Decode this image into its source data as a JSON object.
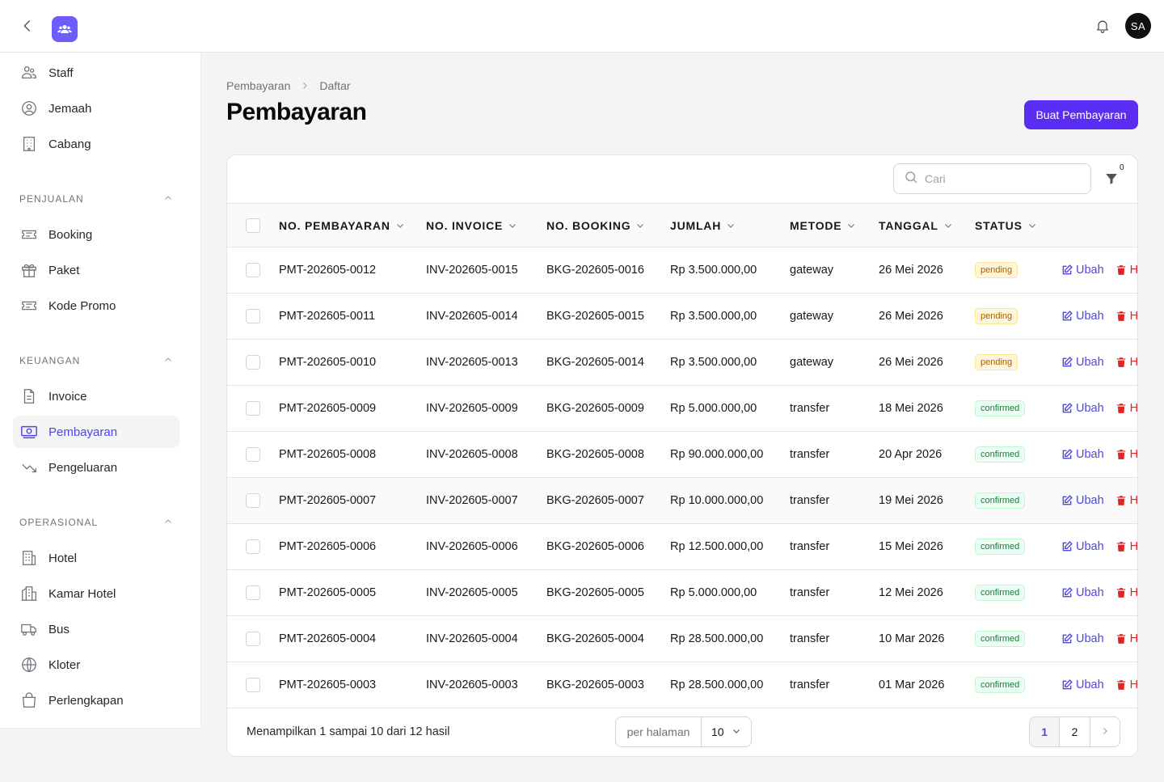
{
  "header": {
    "avatar_initials": "SA",
    "brand_color": "#6d5dfc"
  },
  "sidebar": {
    "top_items": [
      {
        "label": "Staff",
        "icon": "users-icon"
      },
      {
        "label": "Jemaah",
        "icon": "user-circle-icon"
      },
      {
        "label": "Cabang",
        "icon": "building-icon"
      }
    ],
    "groups": [
      {
        "label": "PENJUALAN",
        "items": [
          {
            "label": "Booking",
            "icon": "ticket-icon"
          },
          {
            "label": "Paket",
            "icon": "gift-icon"
          },
          {
            "label": "Kode Promo",
            "icon": "promo-ticket-icon"
          }
        ]
      },
      {
        "label": "KEUANGAN",
        "items": [
          {
            "label": "Invoice",
            "icon": "document-icon"
          },
          {
            "label": "Pembayaran",
            "icon": "banknote-icon",
            "active": true
          },
          {
            "label": "Pengeluaran",
            "icon": "trending-down-icon"
          }
        ]
      },
      {
        "label": "OPERASIONAL",
        "items": [
          {
            "label": "Hotel",
            "icon": "hotel-icon"
          },
          {
            "label": "Kamar Hotel",
            "icon": "hotel-room-icon"
          },
          {
            "label": "Bus",
            "icon": "truck-icon"
          },
          {
            "label": "Kloter",
            "icon": "globe-icon"
          },
          {
            "label": "Perlengkapan",
            "icon": "shopping-bag-icon"
          }
        ]
      }
    ]
  },
  "breadcrumb": {
    "parent": "Pembayaran",
    "current": "Daftar"
  },
  "page": {
    "title": "Pembayaran",
    "create_button": "Buat Pembayaran",
    "accent_color": "#5b2df3"
  },
  "table_toolbar": {
    "search_placeholder": "Cari",
    "filter_count": "0"
  },
  "table": {
    "columns": [
      "NO. PEMBAYARAN",
      "NO. INVOICE",
      "NO. BOOKING",
      "JUMLAH",
      "METODE",
      "TANGGAL",
      "STATUS"
    ],
    "edit_label": "Ubah",
    "delete_label": "H",
    "rows": [
      {
        "no_pembayaran": "PMT-202605-0012",
        "no_invoice": "INV-202605-0015",
        "no_booking": "BKG-202605-0016",
        "jumlah": "Rp 3.500.000,00",
        "metode": "gateway",
        "tanggal": "26 Mei 2026",
        "status": "pending"
      },
      {
        "no_pembayaran": "PMT-202605-0011",
        "no_invoice": "INV-202605-0014",
        "no_booking": "BKG-202605-0015",
        "jumlah": "Rp 3.500.000,00",
        "metode": "gateway",
        "tanggal": "26 Mei 2026",
        "status": "pending"
      },
      {
        "no_pembayaran": "PMT-202605-0010",
        "no_invoice": "INV-202605-0013",
        "no_booking": "BKG-202605-0014",
        "jumlah": "Rp 3.500.000,00",
        "metode": "gateway",
        "tanggal": "26 Mei 2026",
        "status": "pending"
      },
      {
        "no_pembayaran": "PMT-202605-0009",
        "no_invoice": "INV-202605-0009",
        "no_booking": "BKG-202605-0009",
        "jumlah": "Rp 5.000.000,00",
        "metode": "transfer",
        "tanggal": "18 Mei 2026",
        "status": "confirmed"
      },
      {
        "no_pembayaran": "PMT-202605-0008",
        "no_invoice": "INV-202605-0008",
        "no_booking": "BKG-202605-0008",
        "jumlah": "Rp 90.000.000,00",
        "metode": "transfer",
        "tanggal": "20 Apr 2026",
        "status": "confirmed"
      },
      {
        "no_pembayaran": "PMT-202605-0007",
        "no_invoice": "INV-202605-0007",
        "no_booking": "BKG-202605-0007",
        "jumlah": "Rp 10.000.000,00",
        "metode": "transfer",
        "tanggal": "19 Mei 2026",
        "status": "confirmed"
      },
      {
        "no_pembayaran": "PMT-202605-0006",
        "no_invoice": "INV-202605-0006",
        "no_booking": "BKG-202605-0006",
        "jumlah": "Rp 12.500.000,00",
        "metode": "transfer",
        "tanggal": "15 Mei 2026",
        "status": "confirmed"
      },
      {
        "no_pembayaran": "PMT-202605-0005",
        "no_invoice": "INV-202605-0005",
        "no_booking": "BKG-202605-0005",
        "jumlah": "Rp 5.000.000,00",
        "metode": "transfer",
        "tanggal": "12 Mei 2026",
        "status": "confirmed"
      },
      {
        "no_pembayaran": "PMT-202605-0004",
        "no_invoice": "INV-202605-0004",
        "no_booking": "BKG-202605-0004",
        "jumlah": "Rp 28.500.000,00",
        "metode": "transfer",
        "tanggal": "10 Mar 2026",
        "status": "confirmed"
      },
      {
        "no_pembayaran": "PMT-202605-0003",
        "no_invoice": "INV-202605-0003",
        "no_booking": "BKG-202605-0003",
        "jumlah": "Rp 28.500.000,00",
        "metode": "transfer",
        "tanggal": "01 Mar 2026",
        "status": "confirmed"
      }
    ]
  },
  "footer": {
    "summary": "Menampilkan 1 sampai 10 dari 12 hasil",
    "per_page_label": "per halaman",
    "per_page_value": "10",
    "pages": [
      "1",
      "2"
    ],
    "current_page": "1"
  },
  "colors": {
    "pending": "#a16207",
    "confirmed": "#15803d",
    "edit": "#4f46e5",
    "delete": "#dc2626"
  }
}
